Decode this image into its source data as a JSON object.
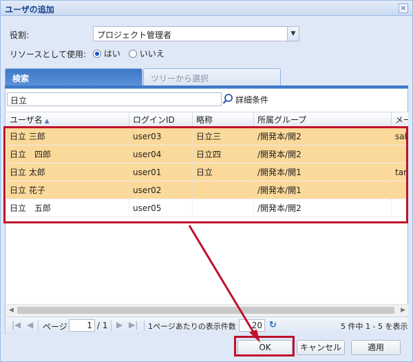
{
  "dialog": {
    "title": "ユーザの追加",
    "close_glyph": "×"
  },
  "form": {
    "role_label": "役割:",
    "role_value": "プロジェクト管理者",
    "use_as_resource_label": "リソースとして使用:",
    "radio_yes": "はい",
    "radio_no": "いいえ",
    "radio_selected": "yes"
  },
  "tabs": [
    {
      "label": "検索",
      "active": true
    },
    {
      "label": "ツリーから選択",
      "active": false
    }
  ],
  "search": {
    "value": "日立",
    "detail_label": "詳細条件"
  },
  "grid": {
    "columns": [
      "ユーザ名",
      "ログインID",
      "略称",
      "所属グループ",
      "メー"
    ],
    "rows": [
      {
        "name": "日立 三郎",
        "login": "user03",
        "abbr": "日立三",
        "group": "/開発本/開2",
        "mail": "sab",
        "selected": true
      },
      {
        "name": "日立　四郎",
        "login": "user04",
        "abbr": "日立四",
        "group": "/開発本/開2",
        "mail": "",
        "selected": true
      },
      {
        "name": "日立 太郎",
        "login": "user01",
        "abbr": "日立",
        "group": "/開発本/開1",
        "mail": "taro",
        "selected": true
      },
      {
        "name": "日立 花子",
        "login": "user02",
        "abbr": "",
        "group": "/開発本/開1",
        "mail": "",
        "selected": true
      },
      {
        "name": "日立　五郎",
        "login": "user05",
        "abbr": "",
        "group": "/開発本/開2",
        "mail": "",
        "selected": false
      }
    ]
  },
  "pager": {
    "page_label": "ページ",
    "page_value": "1",
    "page_total": "/ 1",
    "per_page_label": "1ページあたりの表示件数",
    "per_page_value": "20",
    "summary": "5 件中 1 - 5 を表示"
  },
  "buttons": {
    "ok": "OK",
    "cancel": "キャンセル",
    "apply": "適用"
  },
  "colors": {
    "selected_row": "#fbd99a",
    "annotation_red": "#c0102a"
  }
}
